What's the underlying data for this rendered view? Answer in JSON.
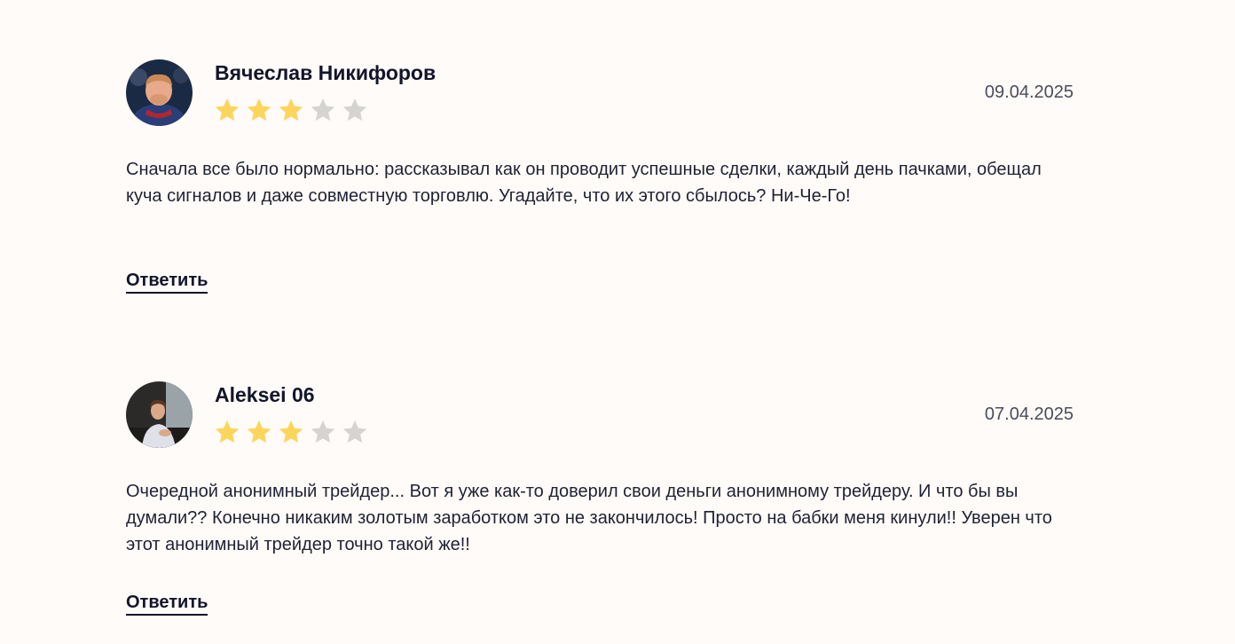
{
  "colors": {
    "background": "#fefbf8",
    "star_filled": "#fcd55c",
    "star_empty": "#d5d4d2",
    "text": "#1a1d2e"
  },
  "reviews": [
    {
      "author": "Вячеслав Никифоров",
      "date": "09.04.2025",
      "rating": 3,
      "rating_max": 5,
      "text": "Сначала все было нормально: рассказывал как он проводит успешные сделки, каждый день пачками, обещал куча сигналов и даже совместную торговлю. Угадайте, что их этого сбылось? Ни-Че-Го!",
      "reply_label": "Ответить",
      "avatar_icon": "user-photo"
    },
    {
      "author": "Aleksei 06",
      "date": "07.04.2025",
      "rating": 3,
      "rating_max": 5,
      "text": "Очередной анонимный трейдер... Вот я уже как-то доверил свои деньги анонимному трейдеру. И что бы вы думали?? Конечно никаким золотым заработком это не закончилось! Просто на бабки меня кинули!! Уверен что этот анонимный трейдер точно такой же!!",
      "reply_label": "Ответить",
      "avatar_icon": "user-photo"
    }
  ]
}
